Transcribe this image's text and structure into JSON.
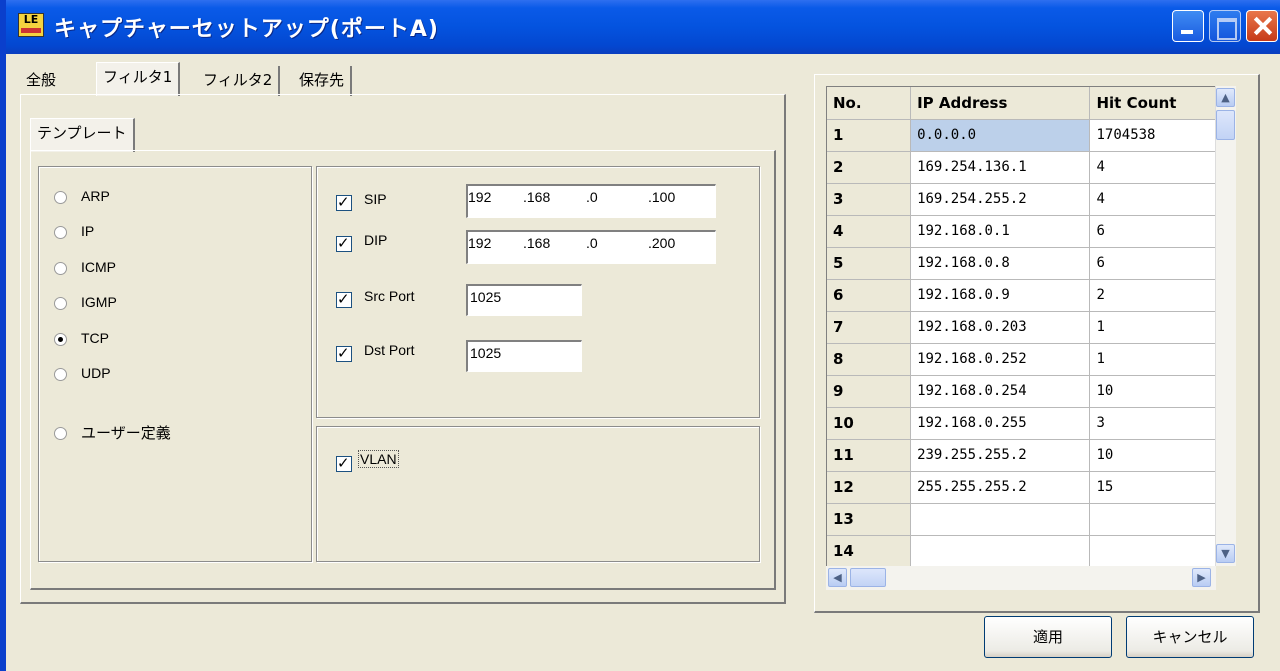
{
  "window": {
    "title": "キャプチャーセットアップ(ポートA)",
    "icon_text": "LE"
  },
  "tabs": [
    {
      "label": "全般",
      "selected": false
    },
    {
      "label": "フィルタ1",
      "selected": true
    },
    {
      "label": "フィルタ2",
      "selected": false
    },
    {
      "label": "保存先",
      "selected": false
    }
  ],
  "subtab": {
    "label": "テンプレート"
  },
  "protocols": [
    {
      "label": "ARP",
      "selected": false
    },
    {
      "label": "IP",
      "selected": false
    },
    {
      "label": "ICMP",
      "selected": false
    },
    {
      "label": "IGMP",
      "selected": false
    },
    {
      "label": "TCP",
      "selected": true
    },
    {
      "label": "UDP",
      "selected": false
    },
    {
      "label": "ユーザー定義",
      "selected": false
    }
  ],
  "filters": {
    "sip": {
      "label": "SIP",
      "checked": true,
      "octets": [
        "192",
        ".168",
        ".0",
        ".100"
      ]
    },
    "dip": {
      "label": "DIP",
      "checked": true,
      "octets": [
        "192",
        ".168",
        ".0",
        ".200"
      ]
    },
    "src_port": {
      "label": "Src Port",
      "checked": true,
      "value": "1025"
    },
    "dst_port": {
      "label": "Dst Port",
      "checked": true,
      "value": "1025"
    },
    "vlan": {
      "label": "VLAN",
      "checked": true
    }
  },
  "grid": {
    "headers": [
      "No.",
      "IP Address",
      "Hit Count"
    ],
    "rows": [
      [
        "1",
        "0.0.0.0",
        "1704538"
      ],
      [
        "2",
        "169.254.136.1",
        "4"
      ],
      [
        "3",
        "169.254.255.2",
        "4"
      ],
      [
        "4",
        "192.168.0.1",
        "6"
      ],
      [
        "5",
        "192.168.0.8",
        "6"
      ],
      [
        "6",
        "192.168.0.9",
        "2"
      ],
      [
        "7",
        "192.168.0.203",
        "1"
      ],
      [
        "8",
        "192.168.0.252",
        "1"
      ],
      [
        "9",
        "192.168.0.254",
        "10"
      ],
      [
        "10",
        "192.168.0.255",
        "3"
      ],
      [
        "11",
        "239.255.255.2",
        "10"
      ],
      [
        "12",
        "255.255.255.2",
        "15"
      ],
      [
        "13",
        "",
        ""
      ],
      [
        "14",
        "",
        ""
      ]
    ]
  },
  "buttons": {
    "apply": "適用",
    "cancel": "キャンセル"
  }
}
